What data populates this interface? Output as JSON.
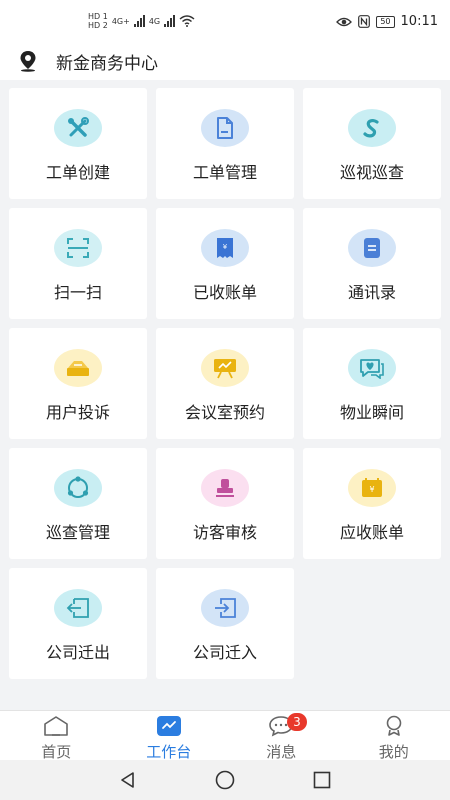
{
  "status_bar": {
    "sim1": "HD 1",
    "sim2": "HD 2",
    "net1": "4G+",
    "net2": "4G",
    "battery": "50",
    "time": "10:11"
  },
  "header": {
    "title": "新金商务中心",
    "icon": "location-pin-icon"
  },
  "grid": {
    "items": [
      {
        "label": "工单创建",
        "icon": "tools-icon",
        "color": "#2f9fb8",
        "bg": "#c9eef3"
      },
      {
        "label": "工单管理",
        "icon": "document-icon",
        "color": "#4b82d8",
        "bg": "#d3e4f7"
      },
      {
        "label": "巡视巡查",
        "icon": "route-s-icon",
        "color": "#2fa0b0",
        "bg": "#c9eef3"
      },
      {
        "label": "扫一扫",
        "icon": "scan-icon",
        "color": "#3aaab8",
        "bg": "#d2f0f4"
      },
      {
        "label": "已收账单",
        "icon": "bill-icon",
        "color": "#3a74d4",
        "bg": "#d3e4f7"
      },
      {
        "label": "通讯录",
        "icon": "contacts-icon",
        "color": "#4a7fd6",
        "bg": "#d3e4f7"
      },
      {
        "label": "用户投诉",
        "icon": "complaint-icon",
        "color": "#e9b310",
        "bg": "#fdf1c4"
      },
      {
        "label": "会议室预约",
        "icon": "meeting-board-icon",
        "color": "#e9b310",
        "bg": "#fdf1c4"
      },
      {
        "label": "物业瞬间",
        "icon": "chat-heart-icon",
        "color": "#2f9fb0",
        "bg": "#c9eef3"
      },
      {
        "label": "巡查管理",
        "icon": "patrol-cycle-icon",
        "color": "#2f9fb0",
        "bg": "#c9eef3"
      },
      {
        "label": "访客审核",
        "icon": "visitor-stamp-icon",
        "color": "#c0509c",
        "bg": "#fbdff0"
      },
      {
        "label": "应收账单",
        "icon": "receivable-icon",
        "color": "#e9b310",
        "bg": "#fdf1c4"
      },
      {
        "label": "公司迁出",
        "icon": "move-out-icon",
        "color": "#2fa0b0",
        "bg": "#c9eef3"
      },
      {
        "label": "公司迁入",
        "icon": "move-in-icon",
        "color": "#4b82d8",
        "bg": "#d3e4f7"
      }
    ]
  },
  "tabbar": {
    "items": [
      {
        "label": "首页",
        "icon": "home-icon",
        "active": false
      },
      {
        "label": "工作台",
        "icon": "workbench-icon",
        "active": true
      },
      {
        "label": "消息",
        "icon": "message-icon",
        "active": false,
        "badge": "3"
      },
      {
        "label": "我的",
        "icon": "profile-icon",
        "active": false
      }
    ]
  },
  "colors": {
    "accent": "#2b7de0",
    "badge": "#e8382b"
  }
}
